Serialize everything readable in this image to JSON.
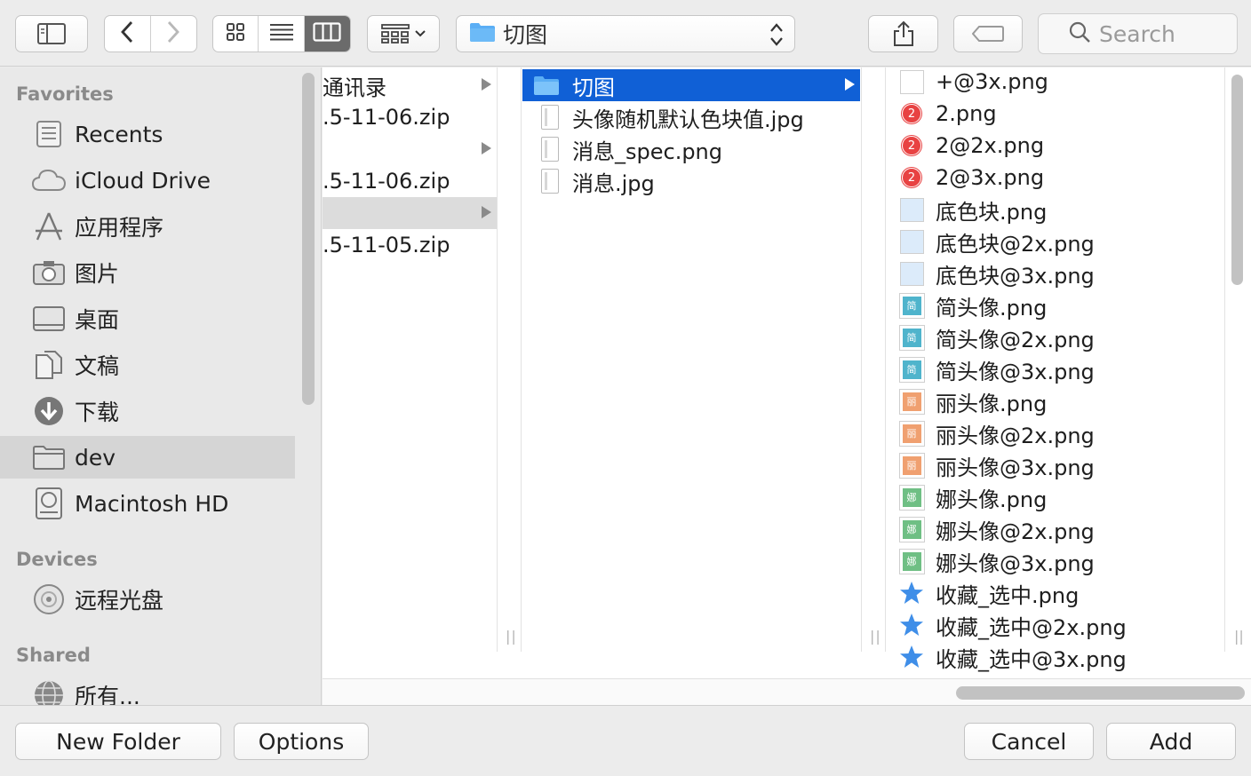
{
  "toolbar": {
    "path_label": "切图",
    "search_placeholder": "Search"
  },
  "sidebar": {
    "favorites_label": "Favorites",
    "favorites": [
      {
        "label": "Recents",
        "icon": "recents-icon"
      },
      {
        "label": "iCloud Drive",
        "icon": "cloud-icon"
      },
      {
        "label": "应用程序",
        "icon": "applications-icon"
      },
      {
        "label": "图片",
        "icon": "camera-icon"
      },
      {
        "label": "桌面",
        "icon": "desktop-icon"
      },
      {
        "label": "文稿",
        "icon": "documents-icon"
      },
      {
        "label": "下载",
        "icon": "download-icon"
      },
      {
        "label": "dev",
        "icon": "folder-icon",
        "selected": true
      },
      {
        "label": "Macintosh HD",
        "icon": "harddisk-icon"
      }
    ],
    "devices_label": "Devices",
    "devices": [
      {
        "label": "远程光盘",
        "icon": "disc-icon"
      }
    ],
    "shared_label": "Shared",
    "shared": [
      {
        "label": "所有...",
        "icon": "network-icon"
      }
    ]
  },
  "column1": {
    "rows": [
      {
        "label": "通讯录",
        "arrow": true
      },
      {
        "label": ".5-11-06.zip",
        "arrow": false
      },
      {
        "label": "",
        "arrow": true
      },
      {
        "label": ".5-11-06.zip",
        "arrow": false
      },
      {
        "label": "",
        "arrow": true,
        "highlight": true
      },
      {
        "label": ".5-11-05.zip",
        "arrow": false
      }
    ]
  },
  "column2": {
    "rows": [
      {
        "label": "切图",
        "type": "folder",
        "selected": true
      },
      {
        "label": "头像随机默认色块值.jpg",
        "type": "doc"
      },
      {
        "label": "消息_spec.png",
        "type": "doc"
      },
      {
        "label": "消息.jpg",
        "type": "doc"
      }
    ]
  },
  "column3": {
    "rows": [
      {
        "label": "+@3x.png",
        "thumb": "blank"
      },
      {
        "label": "2.png",
        "thumb": "badge",
        "badge_text": "2"
      },
      {
        "label": "2@2x.png",
        "thumb": "badge",
        "badge_text": "2"
      },
      {
        "label": "2@3x.png",
        "thumb": "badge",
        "badge_text": "2"
      },
      {
        "label": "底色块.png",
        "thumb": "color",
        "color": "#dcebfa"
      },
      {
        "label": "底色块@2x.png",
        "thumb": "color",
        "color": "#dcebfa"
      },
      {
        "label": "底色块@3x.png",
        "thumb": "color",
        "color": "#dcebfa"
      },
      {
        "label": "简头像.png",
        "thumb": "avatar",
        "color": "#4fb4cc",
        "glyph": "简"
      },
      {
        "label": "简头像@2x.png",
        "thumb": "avatar",
        "color": "#4fb4cc",
        "glyph": "简"
      },
      {
        "label": "简头像@3x.png",
        "thumb": "avatar",
        "color": "#4fb4cc",
        "glyph": "简"
      },
      {
        "label": "丽头像.png",
        "thumb": "avatar",
        "color": "#f0a070",
        "glyph": "丽"
      },
      {
        "label": "丽头像@2x.png",
        "thumb": "avatar",
        "color": "#f0a070",
        "glyph": "丽"
      },
      {
        "label": "丽头像@3x.png",
        "thumb": "avatar",
        "color": "#f0a070",
        "glyph": "丽"
      },
      {
        "label": "娜头像.png",
        "thumb": "avatar",
        "color": "#6fbf84",
        "glyph": "娜"
      },
      {
        "label": "娜头像@2x.png",
        "thumb": "avatar",
        "color": "#6fbf84",
        "glyph": "娜"
      },
      {
        "label": "娜头像@3x.png",
        "thumb": "avatar",
        "color": "#6fbf84",
        "glyph": "娜"
      },
      {
        "label": "收藏_选中.png",
        "thumb": "star"
      },
      {
        "label": "收藏_选中@2x.png",
        "thumb": "star"
      },
      {
        "label": "收藏_选中@3x.png",
        "thumb": "star"
      }
    ]
  },
  "bottom": {
    "new_folder": "New Folder",
    "options": "Options",
    "cancel": "Cancel",
    "add": "Add"
  },
  "colors": {
    "selection": "#1060d6",
    "folder": "#5aaef5",
    "star": "#3f8ee8"
  }
}
